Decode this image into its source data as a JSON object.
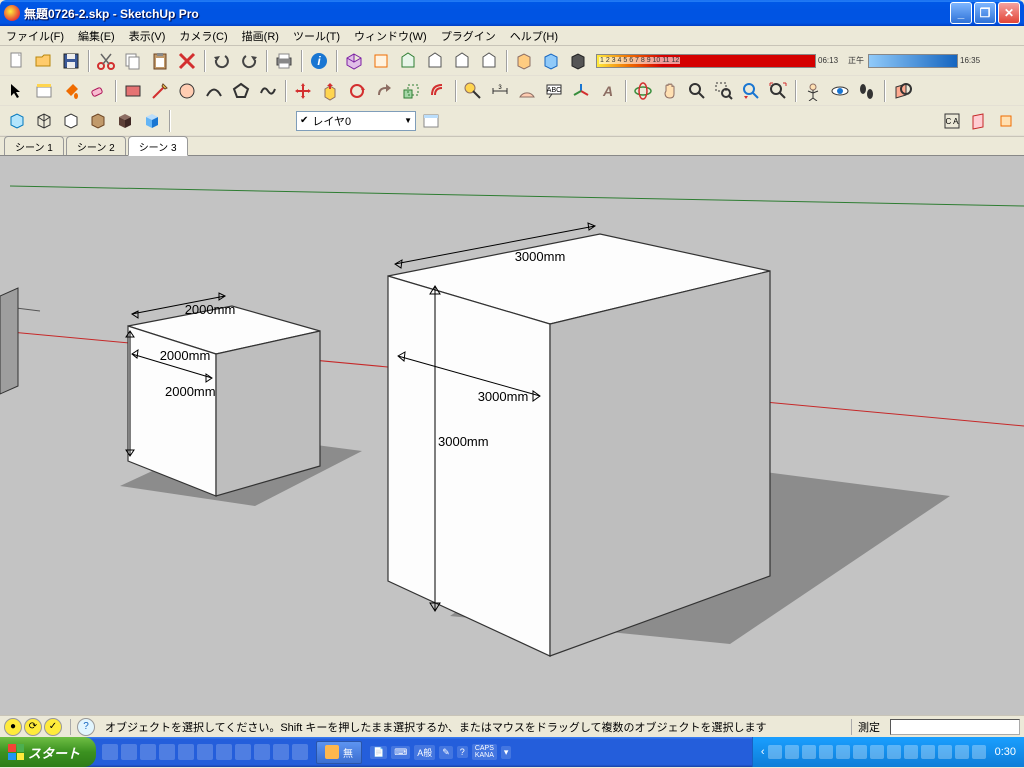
{
  "window": {
    "title": "無題0726-2.skp - SketchUp Pro"
  },
  "menu": {
    "file": "ファイル(F)",
    "edit": "編集(E)",
    "view": "表示(V)",
    "camera": "カメラ(C)",
    "draw": "描画(R)",
    "tools": "ツール(T)",
    "window": "ウィンドウ(W)",
    "plugins": "プラグイン",
    "help": "ヘルプ(H)"
  },
  "shadow_bar": {
    "ticks": "1 2 3 4 5 6 7 8 9 10 11 12",
    "date": "06:13",
    "ampm": "正午",
    "time": "16:35"
  },
  "layer": {
    "current": "レイヤ0"
  },
  "scenes": {
    "tab1": "シーン 1",
    "tab2": "シーン 2",
    "tab3": "シーン 3"
  },
  "model": {
    "cube_small": {
      "width": "2000mm",
      "depth": "2000mm",
      "height": "2000mm"
    },
    "cube_large": {
      "width": "3000mm",
      "depth": "3000mm",
      "height": "3000mm"
    }
  },
  "status": {
    "message": "オブジェクトを選択してください。Shift キーを押したまま選択するか、またはマウスをドラッグして複数のオブジェクトを選択します",
    "measure_label": "測定"
  },
  "taskbar": {
    "start": "スタート",
    "task1": "無",
    "ime1": "A般",
    "ime2": "CAPS",
    "ime3": "KANA",
    "clock": "0:30"
  }
}
